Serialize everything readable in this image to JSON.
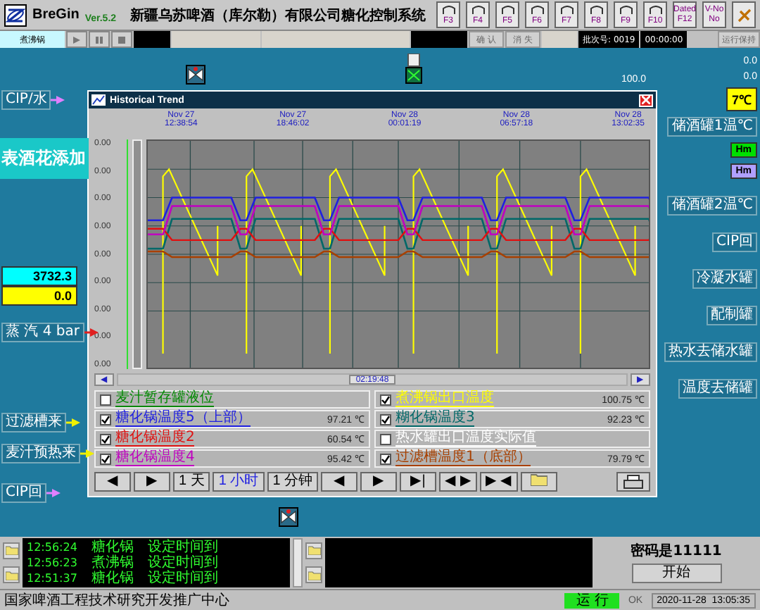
{
  "header": {
    "brand": "BreGin",
    "version": "Ver.5.2",
    "title": "新疆乌苏啤酒（库尔勒）有限公司糖化控制系统",
    "fkeys": [
      {
        "label": "F3"
      },
      {
        "label": "F4"
      },
      {
        "label": "F5"
      },
      {
        "label": "F6"
      },
      {
        "label": "F7"
      },
      {
        "label": "F8"
      },
      {
        "label": "F9"
      },
      {
        "label": "F10"
      },
      {
        "label": "F12",
        "caption": "Dated"
      },
      {
        "label": "No",
        "caption": "V-No"
      }
    ]
  },
  "toolbar": {
    "unit_tab": "煮沸锅",
    "confirm": "确 认",
    "clear": "消 失",
    "batch_label": "批次号:",
    "batch": "0019",
    "timer": "00:00:00",
    "run_hold": "运行保持"
  },
  "process": {
    "setpoint": "100.0",
    "right_values": [
      "0.0",
      "0.0"
    ],
    "left": [
      {
        "kind": "label",
        "text": "CIP/水"
      },
      {
        "kind": "big",
        "text": "表酒花添加"
      },
      {
        "kind": "reading",
        "text": "3732.3",
        "color": "#00ffff"
      },
      {
        "kind": "reading",
        "text": "0.0",
        "color": "#ffff00"
      },
      {
        "kind": "label",
        "text": "蒸 汽 4 bar"
      },
      {
        "kind": "label",
        "text": "过滤槽来"
      },
      {
        "kind": "label",
        "text": "麦汁预热来"
      }
    ],
    "right": [
      {
        "kind": "tag",
        "text": "7℃",
        "color": "#ffff00"
      },
      {
        "kind": "label",
        "text": "储酒罐1温℃"
      },
      {
        "kind": "tag",
        "text": "Hm",
        "color": "#00e000"
      },
      {
        "kind": "tag",
        "text": "Hm",
        "color": "#b0a0ff"
      },
      {
        "kind": "label",
        "text": "储酒罐2温℃"
      },
      {
        "kind": "label",
        "text": "CIP回"
      },
      {
        "kind": "label",
        "text": "冷凝水罐"
      },
      {
        "kind": "label",
        "text": "配制罐"
      },
      {
        "kind": "label",
        "text": "热水去储水罐"
      },
      {
        "kind": "label",
        "text": "温度去储罐"
      }
    ],
    "bottom_label": "CIP回"
  },
  "trend": {
    "title": "Historical Trend",
    "times": [
      {
        "date": "Nov 27",
        "time": "12:38:54"
      },
      {
        "date": "Nov 27",
        "time": "18:46:02"
      },
      {
        "date": "Nov 28",
        "time": "00:01:19"
      },
      {
        "date": "Nov 28",
        "time": "06:57:18"
      },
      {
        "date": "Nov 28",
        "time": "13:02:35"
      }
    ],
    "yticks": [
      "0.00",
      "0.00",
      "0.00",
      "0.00",
      "0.00",
      "0.00",
      "0.00",
      "0.00",
      "0.00"
    ],
    "cursor_time": "02:19:48",
    "scroll_buttons": [
      "◀",
      "▶"
    ],
    "legend": [
      {
        "name": "麦汁暂存罐液位",
        "checked": false,
        "color": "#008800"
      },
      {
        "name": "煮沸锅出口温度",
        "value": "100.75 ℃",
        "checked": true,
        "color": "#ffff00"
      },
      {
        "name": "糖化锅温度5（上部）",
        "value": "97.21 ℃",
        "checked": true,
        "color": "#2020e0"
      },
      {
        "name": "糊化锅温度3",
        "value": "92.23 ℃",
        "checked": true,
        "color": "#006868"
      },
      {
        "name": "糖化锅温度2",
        "value": "60.54 ℃",
        "checked": true,
        "color": "#e01010"
      },
      {
        "name": "热水罐出口温度实际值",
        "checked": false,
        "color": "#ffffff"
      },
      {
        "name": "糖化锅温度4",
        "value": "95.42 ℃",
        "checked": true,
        "color": "#c000c0"
      },
      {
        "name": "过滤槽温度1（底部）",
        "value": "79.79 ℃",
        "checked": true,
        "color": "#a84000"
      }
    ],
    "buttons": [
      {
        "kind": "text",
        "text": "◀",
        "selected": false
      },
      {
        "kind": "text",
        "text": "▶",
        "selected": false
      },
      {
        "kind": "text",
        "text": "1 天",
        "selected": false
      },
      {
        "kind": "text",
        "text": "1 小时",
        "selected": true
      },
      {
        "kind": "text",
        "text": "1 分钟",
        "selected": false
      },
      {
        "kind": "text",
        "text": "◀",
        "selected": false
      },
      {
        "kind": "text",
        "text": "▶",
        "selected": false
      },
      {
        "kind": "text",
        "text": "▶|",
        "selected": false
      },
      {
        "kind": "text",
        "text": "◀ ▶",
        "selected": false
      },
      {
        "kind": "text",
        "text": "▶ ◀",
        "selected": false
      },
      {
        "kind": "folder"
      },
      {
        "kind": "printer"
      }
    ]
  },
  "alarms": [
    {
      "time": "12:56:24",
      "unit": "糖化锅",
      "message": "设定时间到"
    },
    {
      "time": "12:56:23",
      "unit": "煮沸锅",
      "message": "设定时间到"
    },
    {
      "time": "12:51:37",
      "unit": "糖化锅",
      "message": "设定时间到"
    }
  ],
  "password_note": "密码是11111",
  "start_button": "开始",
  "status_bar": {
    "org": "国家啤酒工程技术研究开发推广中心",
    "run": "运 行",
    "ok": "OK",
    "datetime": "2020-11-28  13:05:35"
  }
}
